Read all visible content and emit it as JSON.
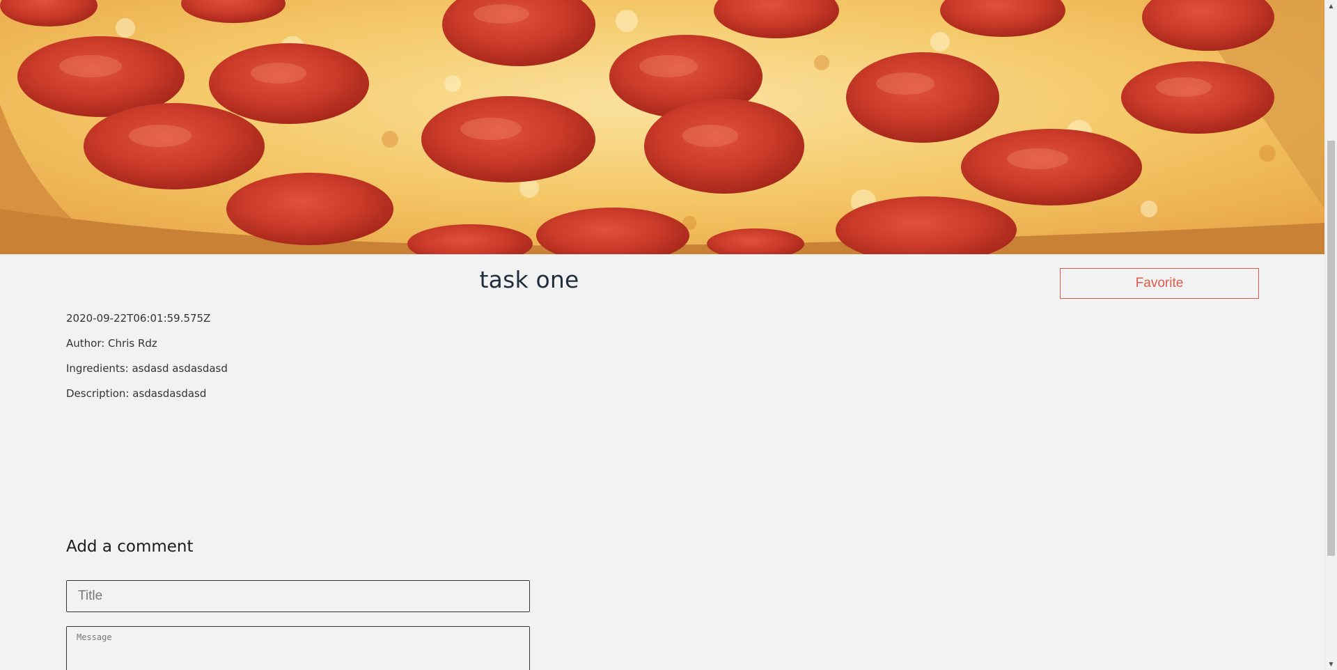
{
  "post": {
    "title": "task one",
    "favorite_label": "Favorite",
    "date": "2020-09-22T06:01:59.575Z",
    "author": "Author: Chris Rdz",
    "ingredients": "Ingredients: asdasd asdasdasd",
    "description": "Description: asdasdasdasd"
  },
  "comment_form": {
    "heading": "Add a comment",
    "title_placeholder": "Title",
    "message_placeholder": "Message"
  },
  "colors": {
    "background": "#f2f2f2",
    "accent": "#e05a4b",
    "title_text": "#1f2d3d"
  },
  "icons": {
    "scroll_up": "triangle-up-icon",
    "scroll_down": "triangle-down-icon"
  }
}
